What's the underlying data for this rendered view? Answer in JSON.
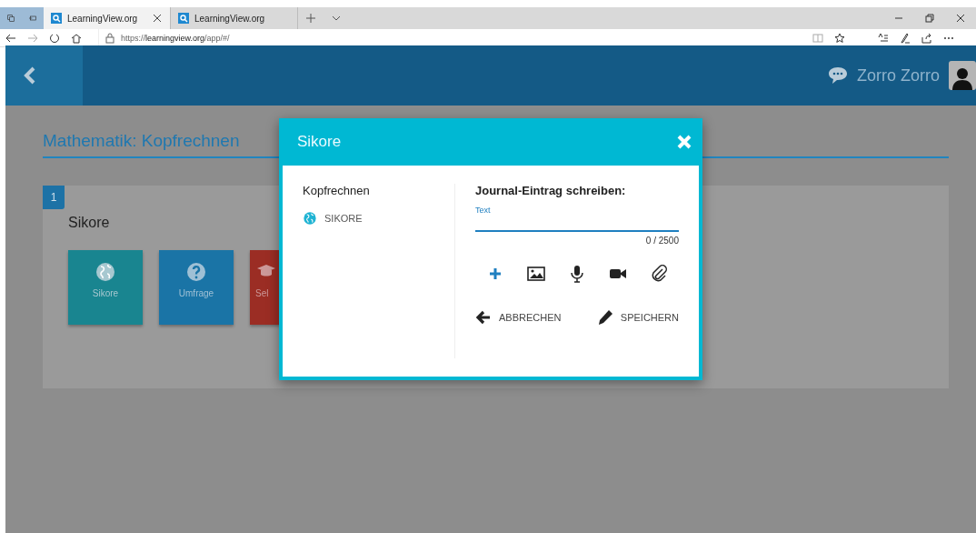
{
  "browser": {
    "tabs": [
      {
        "title": "LearningView.org",
        "selected": true
      },
      {
        "title": "LearningView.org",
        "selected": false
      }
    ],
    "url_prefix": "https://",
    "url_host": "learningview.org",
    "url_path": "/app/#/"
  },
  "header": {
    "user_name": "Zorro Zorro"
  },
  "page": {
    "title": "Mathematik: Kopfrechnen",
    "section": {
      "number": "1",
      "title": "Sikore",
      "tiles": [
        {
          "kind": "globe",
          "label": "Sikore"
        },
        {
          "kind": "question",
          "label": "Umfrage"
        },
        {
          "kind": "cap",
          "label": "Sel"
        }
      ]
    }
  },
  "modal": {
    "title": "Sikore",
    "left_title": "Kopfrechnen",
    "left_item": "SIKORE",
    "form_title": "Journal-Eintrag schreiben:",
    "field": {
      "placeholder": "Text"
    },
    "counter": "0 / 2500",
    "buttons": [
      {
        "kind": "back",
        "label": "ABBRECHEN"
      },
      {
        "kind": "pencil",
        "label": "SPEICHERN"
      }
    ]
  }
}
